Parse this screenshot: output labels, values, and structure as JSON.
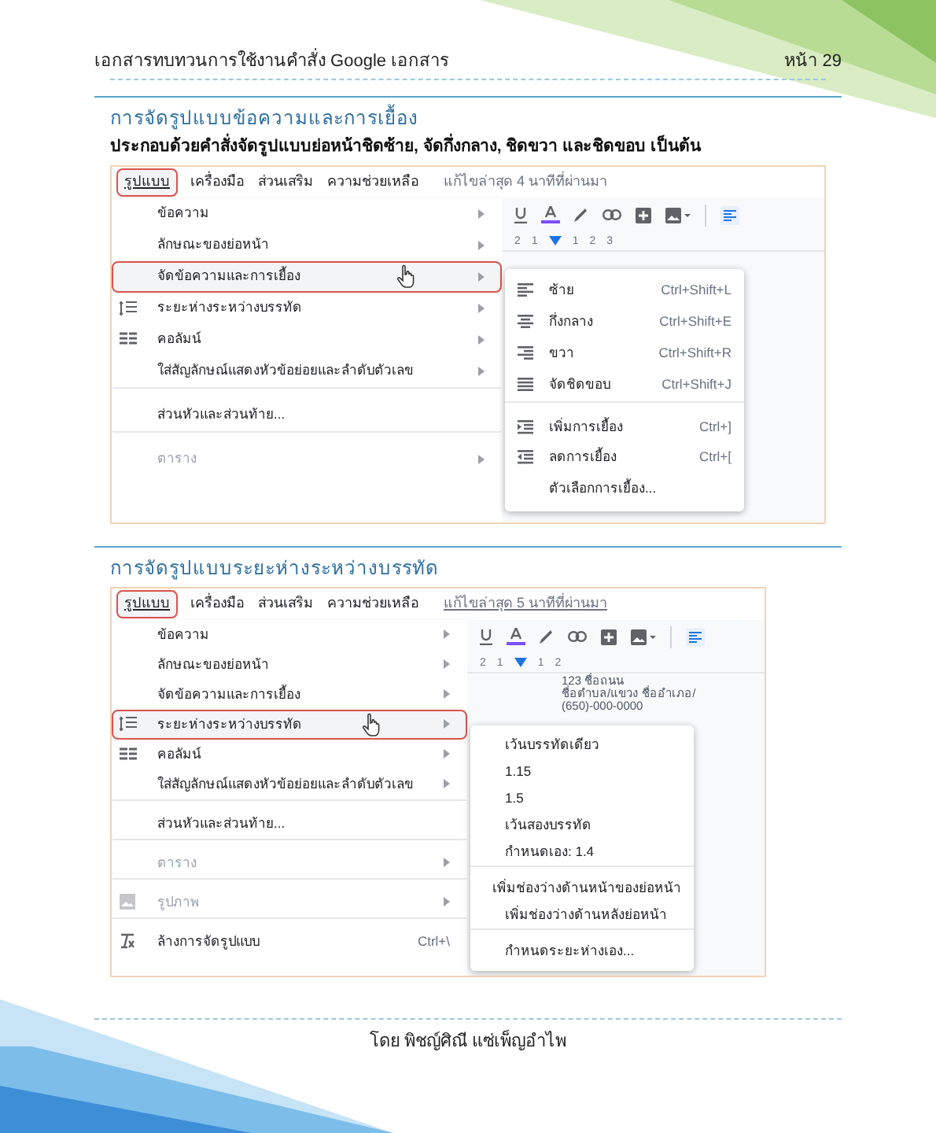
{
  "header": {
    "title": "เอกสารทบทวนการใช้งานคำสั่ง Google เอกสาร",
    "page": "หน้า 29"
  },
  "sections": [
    {
      "heading": "การจัดรูปแบบข้อความและการเยื้อง",
      "description": "ประกอบด้วยคำสั่งจัดรูปแบบย่อหน้าชิดซ้าย, จัดกึ่งกลาง, ชิดขวา และชิดขอบ เป็นต้น",
      "screenshot": {
        "menubar": [
          {
            "label": "รูปแบบ",
            "selected": true
          },
          {
            "label": "เครื่องมือ",
            "selected": false
          },
          {
            "label": "ส่วนเสริม",
            "selected": false
          },
          {
            "label": "ความช่วยเหลือ",
            "selected": false
          }
        ],
        "last_edit": {
          "text": "แก้ไขล่าสุด 4 นาทีที่ผ่านมา",
          "underlined": false
        },
        "ruler": [
          "2",
          "1",
          "1",
          "2",
          "3"
        ],
        "menu": [
          {
            "label": "ข้อความ",
            "kind": "plain",
            "submenu": true,
            "selected": false,
            "disabled": false,
            "divider_before": false
          },
          {
            "label": "ลักษณะของย่อหน้า",
            "kind": "plain",
            "submenu": true,
            "selected": false,
            "disabled": false,
            "divider_before": false
          },
          {
            "label": "จัดข้อความและการเยื้อง",
            "kind": "plain",
            "submenu": true,
            "selected": true,
            "disabled": false,
            "divider_before": false
          },
          {
            "label": "ระยะห่างระหว่างบรรทัด",
            "kind": "spacing",
            "submenu": true,
            "selected": false,
            "disabled": false,
            "divider_before": false
          },
          {
            "label": "คอลัมน์",
            "kind": "columns",
            "submenu": true,
            "selected": false,
            "disabled": false,
            "divider_before": false
          },
          {
            "label": "ใส่สัญลักษณ์แสดงหัวข้อย่อยและลำดับตัวเลข",
            "kind": "plain",
            "submenu": true,
            "selected": false,
            "disabled": false,
            "divider_before": false
          },
          {
            "label": "ส่วนหัวและส่วนท้าย...",
            "kind": "plain",
            "submenu": false,
            "selected": false,
            "disabled": false,
            "divider_before": true
          },
          {
            "label": "ตาราง",
            "kind": "plain",
            "submenu": true,
            "selected": false,
            "disabled": true,
            "divider_before": true
          }
        ],
        "submenu": [
          {
            "label": "ซ้าย",
            "kind": "align-left",
            "shortcut": "Ctrl+Shift+L",
            "divider_before": false
          },
          {
            "label": "กึ่งกลาง",
            "kind": "align-center",
            "shortcut": "Ctrl+Shift+E",
            "divider_before": false
          },
          {
            "label": "ขวา",
            "kind": "align-right",
            "shortcut": "Ctrl+Shift+R",
            "divider_before": false
          },
          {
            "label": "จัดชิดขอบ",
            "kind": "justify",
            "shortcut": "Ctrl+Shift+J",
            "divider_before": false
          },
          {
            "label": "เพิ่มการเยื้อง",
            "kind": "indent-more",
            "shortcut": "Ctrl+]",
            "divider_before": true
          },
          {
            "label": "ลดการเยื้อง",
            "kind": "indent-less",
            "shortcut": "Ctrl+[",
            "divider_before": false
          },
          {
            "label": "ตัวเลือกการเยื้อง...",
            "kind": "plain",
            "divider_before": false
          }
        ]
      }
    },
    {
      "heading": "การจัดรูปแบบระยะห่างระหว่างบรรทัด",
      "screenshot": {
        "menubar": [
          {
            "label": "รูปแบบ",
            "selected": true
          },
          {
            "label": "เครื่องมือ",
            "selected": false
          },
          {
            "label": "ส่วนเสริม",
            "selected": false
          },
          {
            "label": "ความช่วยเหลือ",
            "selected": false
          }
        ],
        "last_edit": {
          "text": "แก้ไขล่าสุด 5 นาทีที่ผ่านมา",
          "underlined": true
        },
        "ruler": [
          "2",
          "1",
          "1",
          "2"
        ],
        "doc_lines": [
          "123 ชื่อถนน",
          "ชื่อตำบล/แขวง ชื่ออำเภอ/",
          "(650)-000-0000"
        ],
        "menu": [
          {
            "label": "ข้อความ",
            "kind": "plain",
            "submenu": true,
            "selected": false,
            "disabled": false,
            "divider_before": false
          },
          {
            "label": "ลักษณะของย่อหน้า",
            "kind": "plain",
            "submenu": true,
            "selected": false,
            "disabled": false,
            "divider_before": false
          },
          {
            "label": "จัดข้อความและการเยื้อง",
            "kind": "plain",
            "submenu": true,
            "selected": false,
            "disabled": false,
            "divider_before": false
          },
          {
            "label": "ระยะห่างระหว่างบรรทัด",
            "kind": "spacing",
            "submenu": true,
            "selected": true,
            "disabled": false,
            "divider_before": false
          },
          {
            "label": "คอลัมน์",
            "kind": "columns",
            "submenu": true,
            "selected": false,
            "disabled": false,
            "divider_before": false
          },
          {
            "label": "ใส่สัญลักษณ์แสดงหัวข้อย่อยและลำดับตัวเลข",
            "kind": "plain",
            "submenu": true,
            "selected": false,
            "disabled": false,
            "divider_before": false
          },
          {
            "label": "ส่วนหัวและส่วนท้าย...",
            "kind": "plain",
            "submenu": false,
            "selected": false,
            "disabled": false,
            "divider_before": true
          },
          {
            "label": "ตาราง",
            "kind": "plain",
            "submenu": true,
            "selected": false,
            "disabled": true,
            "divider_before": true
          },
          {
            "label": "รูปภาพ",
            "kind": "image",
            "submenu": true,
            "selected": false,
            "disabled": true,
            "divider_before": true
          },
          {
            "label": "ล้างการจัดรูปแบบ",
            "kind": "clear",
            "submenu": false,
            "shortcut": "Ctrl+\\",
            "selected": false,
            "disabled": false,
            "divider_before": true
          }
        ],
        "submenu": [
          {
            "label": "เว้นบรรทัดเดียว",
            "kind": "plain",
            "divider_before": false
          },
          {
            "label": "1.15",
            "kind": "plain",
            "divider_before": false
          },
          {
            "label": "1.5",
            "kind": "plain",
            "divider_before": false
          },
          {
            "label": "เว้นสองบรรทัด",
            "kind": "plain",
            "divider_before": false
          },
          {
            "label": "กำหนดเอง: 1.4",
            "kind": "plain",
            "divider_before": false
          },
          {
            "label": "เพิ่มช่องว่างด้านหน้าของย่อหน้า",
            "kind": "plain",
            "divider_before": true
          },
          {
            "label": "เพิ่มช่องว่างด้านหลังย่อหน้า",
            "kind": "plain",
            "divider_before": false
          },
          {
            "label": "กำหนดระยะห่างเอง...",
            "kind": "plain",
            "divider_before": true
          }
        ]
      }
    }
  ],
  "footer": "โดย พิชญ์ศิณี แซ่เพ็ญอำไพ"
}
